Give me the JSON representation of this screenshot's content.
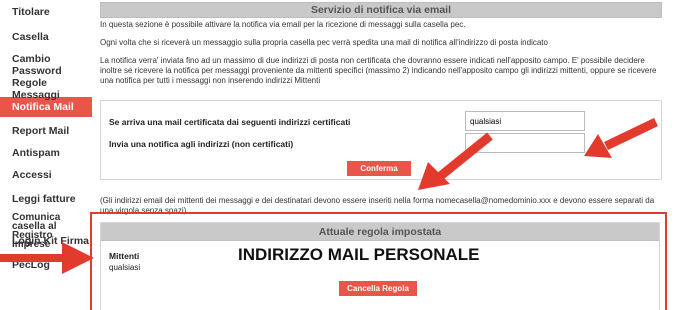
{
  "sidebar": {
    "items": [
      {
        "label": "Titolare",
        "active": false
      },
      {
        "label": "Casella",
        "active": false
      },
      {
        "label": "Cambio Password",
        "active": false
      },
      {
        "label": "Regole Messaggi",
        "active": false
      },
      {
        "label": "Notifica Mail",
        "active": true
      },
      {
        "label": "Report Mail",
        "active": false
      },
      {
        "label": "Antispam",
        "active": false
      },
      {
        "label": "Accessi",
        "active": false
      },
      {
        "label": "Leggi fatture",
        "active": false
      },
      {
        "label": "Comunica casella al Registro Imprese",
        "active": false
      },
      {
        "label": "Login Kit Firma",
        "active": false
      },
      {
        "label": "PecLog",
        "active": false
      }
    ]
  },
  "main": {
    "title": "Servizio di notifica via email",
    "intro1": "In questa sezione è possibile attivare la notifica via email per la ricezione di messaggi sulla casella pec.",
    "intro2": "Ogni volta che si riceverà un messaggio sulla propria casella pec verrà spedita una mail di notifica all'indirizzo di posta indicato",
    "intro3": "La notifica verra' inviata fino ad un massimo di due indirizzi di posta non certificata che dovranno essere indicati nell'apposito campo. E' possibile decidere inoltre se ricevere la notifica per messaggi proveniente da mittenti specifici (massimo 2) indicando nell'apposito campo gli indirizzi mittenti, oppure se ricevere una notifica per tutti i messaggi non inserendo indirizzi Mittenti",
    "form": {
      "label_certified": "Se arriva una mail certificata dai seguenti indirizzi certificati",
      "value_certified": "qualsiasi",
      "label_notify": "Invia una notifica agli indirizzi (non certificati)",
      "value_notify": "",
      "confirm_label": "Conferma"
    },
    "note": "(Gli indirizzi email dei mittenti dei messaggi e dei destinatari devono essere inseriti nella forma nomecasella@nomedominio.xxx e devono essere separati da una virgola senza spazi)",
    "rule": {
      "title": "Attuale regola impostata",
      "senders_label": "Mittenti",
      "senders_value": "qualsiasi",
      "recipient": "INDIRIZZO MAIL PERSONALE",
      "delete_label": "Cancella Regola"
    }
  },
  "colors": {
    "accent": "#e8564a",
    "highlight": "#e33a2e",
    "header_bg": "#c9c9c9"
  }
}
